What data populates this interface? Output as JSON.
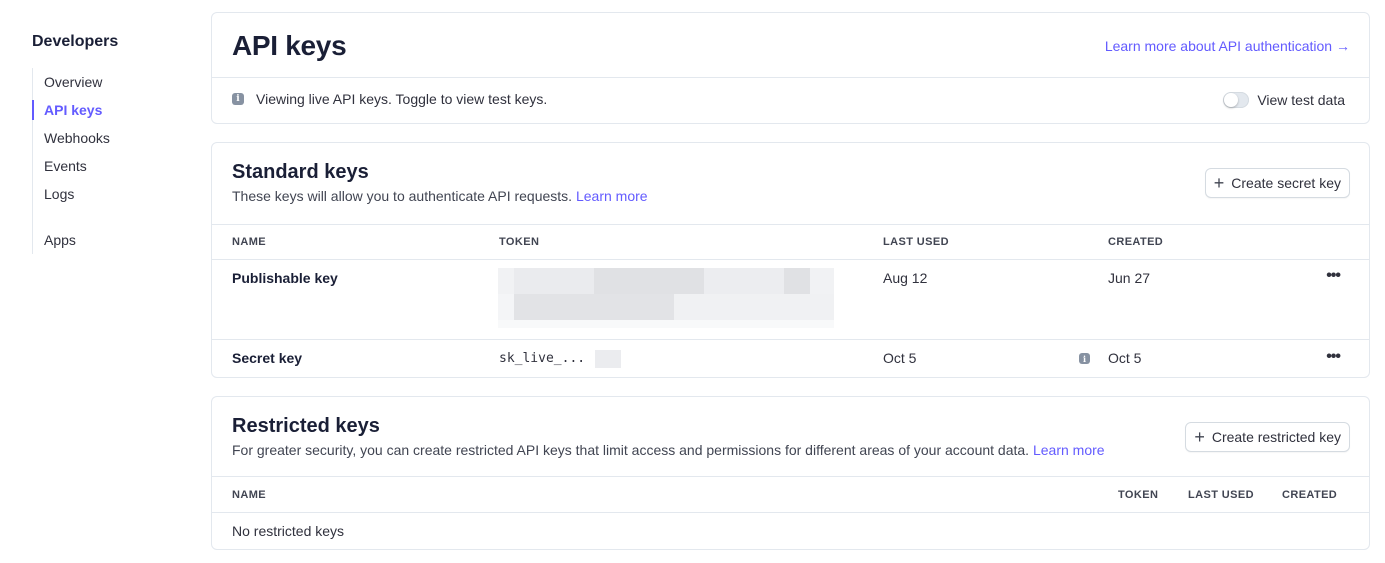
{
  "sidebar": {
    "title": "Developers",
    "items": [
      {
        "label": "Overview"
      },
      {
        "label": "API keys"
      },
      {
        "label": "Webhooks"
      },
      {
        "label": "Events"
      },
      {
        "label": "Logs"
      },
      {
        "label": "Apps"
      }
    ]
  },
  "header": {
    "title": "API keys",
    "learn_link": "Learn more about API authentication →",
    "info_text": "Viewing live API keys. Toggle to view test keys.",
    "toggle_label": "View test data"
  },
  "standard": {
    "title": "Standard keys",
    "description": "These keys will allow you to authenticate API requests.",
    "learn_more": "Learn more",
    "button": "Create secret key",
    "columns": [
      "NAME",
      "TOKEN",
      "LAST USED",
      "CREATED"
    ],
    "rows": [
      {
        "name": "Publishable key",
        "token": "",
        "last_used": "Aug 12",
        "created": "Jun 27"
      },
      {
        "name": "Secret key",
        "token": "sk_live_...",
        "last_used": "Oct 5",
        "created": "Oct 5"
      }
    ],
    "row_menu": "•••"
  },
  "restricted": {
    "title": "Restricted keys",
    "description": "For greater security, you can create restricted API keys that limit access and permissions for different areas of your account data.",
    "learn_more": "Learn more",
    "button": "Create restricted key",
    "columns": [
      "NAME",
      "TOKEN",
      "LAST USED",
      "CREATED"
    ],
    "empty": "No restricted keys"
  },
  "colors": {
    "accent": "#635bff",
    "border": "#e3e8ee",
    "text": "#1a1f36"
  },
  "icons": {
    "info": "info-icon",
    "plus": "plus-icon",
    "more": "more-icon",
    "arrow": "arrow-right-icon"
  }
}
